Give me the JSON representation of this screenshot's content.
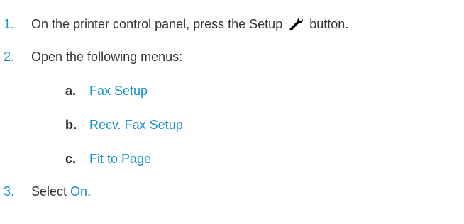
{
  "steps": [
    {
      "number": "1.",
      "text_before": "On the printer control panel, press the Setup",
      "text_after": "button.",
      "icon": "wrench-icon"
    },
    {
      "number": "2.",
      "text": "Open the following menus:",
      "submenus": [
        {
          "letter": "a.",
          "label": "Fax Setup"
        },
        {
          "letter": "b.",
          "label": "Recv. Fax Setup"
        },
        {
          "letter": "c.",
          "label": "Fit to Page"
        }
      ]
    },
    {
      "number": "3.",
      "text_before": "Select",
      "option": "On",
      "text_after": "."
    }
  ],
  "colors": {
    "accent": "#1592c9",
    "text": "#333333",
    "letter": "#222222"
  }
}
